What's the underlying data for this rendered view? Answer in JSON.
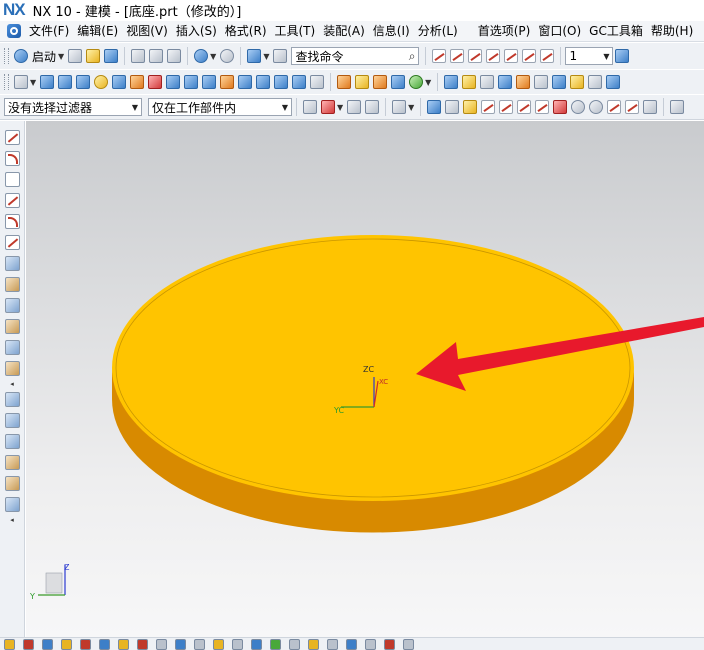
{
  "window": {
    "logo": "NX",
    "title": "NX 10 - 建模 - [底座.prt（修改的）]"
  },
  "menu": {
    "items": [
      "文件(F)",
      "编辑(E)",
      "视图(V)",
      "插入(S)",
      "格式(R)",
      "工具(T)",
      "装配(A)",
      "信息(I)",
      "分析(L)"
    ],
    "right_items": [
      "首选项(P)",
      "窗口(O)",
      "GC工具箱",
      "帮助(H)"
    ]
  },
  "toolbar": {
    "start_label": "启动",
    "search_placeholder": "查找命令",
    "layer_value": "1"
  },
  "selection_bar": {
    "filter_value": "没有选择过滤器",
    "scope_value": "仅在工作部件内"
  },
  "viewport": {
    "wcs_labels": {
      "zc": "ZC",
      "yc": "YC",
      "xc": "XC"
    },
    "triad_labels": {
      "z": "Z",
      "y": "Y"
    },
    "colors": {
      "disk_top": "#ffc400",
      "disk_side": "#d88a00",
      "arrow": "#e8192c"
    }
  },
  "icons": [
    "nx-logo-icon",
    "start-icon",
    "new-file-icon",
    "open-icon",
    "save-icon",
    "cut-icon",
    "copy-icon",
    "paste-icon",
    "undo-icon",
    "redo-icon",
    "search-icon",
    "feature-icons",
    "curve-icons",
    "selection-filter-icons"
  ]
}
